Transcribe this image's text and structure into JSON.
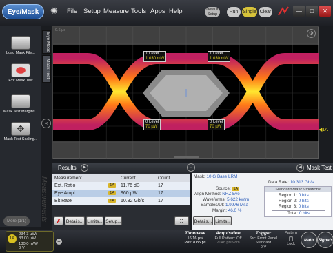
{
  "topbar": {
    "mode_label": "Eye/Mask",
    "menus": [
      "File",
      "Setup",
      "Measure",
      "Tools",
      "Apps",
      "Help"
    ],
    "pill_default_l1": "Default",
    "pill_default_l2": "Setup",
    "pill_run": "Run",
    "pill_single": "Single",
    "pill_clear": "Clear",
    "min_glyph": "—",
    "max_glyph": "□",
    "close_glyph": "✕"
  },
  "left_panel": {
    "tools": [
      "Load Mask File...",
      "Exit Mask Test",
      "Mask Test Margins...",
      "Mask Test Scaling..."
    ],
    "tab_eye": "Eye Meas",
    "tab_mask": "Mask Test",
    "more_label": "More (1/1)",
    "watermark": "Measurements"
  },
  "scope": {
    "top_label": "0.6 µs",
    "level_upper_left": "1 Level",
    "level_upper_left_val": "1.030 mW",
    "level_upper_right": "1 Level",
    "level_upper_right_val": "1.030 mW",
    "level_lower_left": "0 Level",
    "level_lower_left_val": "70 µW",
    "level_lower_right": "0 Level",
    "level_lower_right_val": "70 µW",
    "channel_marker": "◀1A",
    "colors": {
      "trace_hot": "#ffe830",
      "trace_mid": "#ff7a18",
      "trace_cold": "#c02060",
      "mask": "#8a8a8a"
    }
  },
  "results": {
    "title": "Results",
    "headers": [
      "Measurement",
      "Current",
      "Count"
    ],
    "rows": [
      {
        "name": "Ext. Ratio",
        "src": "1A",
        "current": "11.76 dB",
        "count": "17"
      },
      {
        "name": "Eye Ampl",
        "src": "1A",
        "current": "960 µW",
        "count": "17"
      },
      {
        "name": "Bit Rate",
        "src": "1A",
        "current": "10.32 Gb/s",
        "count": "17"
      }
    ],
    "btn_details": "Details...",
    "btn_limits": "Limits...",
    "btn_setup": "Setup..."
  },
  "mask": {
    "title": "Mask Test",
    "mask_label": "Mask:",
    "mask_value": "10 G Base LRM",
    "data_rate_label": "Data Rate:",
    "data_rate_value": "10.313 Gb/s",
    "source_label": "Source:",
    "source_value": "1A",
    "align_label": "Align Method:",
    "align_value": "NRZ Eye",
    "waveforms_label": "Waveforms:",
    "waveforms_value": "5.622 kwfm",
    "samples_label": "Samples/UI:",
    "samples_value": "1.9976 Msa",
    "margin_label": "Margin:",
    "margin_value": "46.0 %",
    "violations_header": "Standard Mask Violations",
    "region1": "Region 1:",
    "region1_val": "0 hits",
    "region2": "Region 2:",
    "region2_val": "0 hits",
    "region3": "Region 3:",
    "region3_val": "0 hits",
    "total": "Total:",
    "total_val": "0 hits",
    "btn_details": "Details...",
    "btn_limits": "Limits..."
  },
  "bottom": {
    "ch1_badge": "1A",
    "ch1_line1": "234.3 µW/",
    "ch1_line2": "83.00 µW",
    "ch1_line3": "130.0 mW/",
    "ch1_line4": "0 V",
    "timebase_h": "Timebase",
    "timebase_1": "16.16 ps/",
    "timebase_2": "Pos: 8.85 ps",
    "acq_h": "Acquisition",
    "acq_1": "Full Pattern: Off",
    "acq_2": "2048 pts/wfm",
    "trig_h": "Trigger",
    "trig_1": "Src: Front Panel",
    "trig_2": "Standard",
    "trig_3": "0 V",
    "pattern_h": "Pattern",
    "pattern_1": "Lock",
    "math": "Math",
    "signals": "Signals"
  }
}
